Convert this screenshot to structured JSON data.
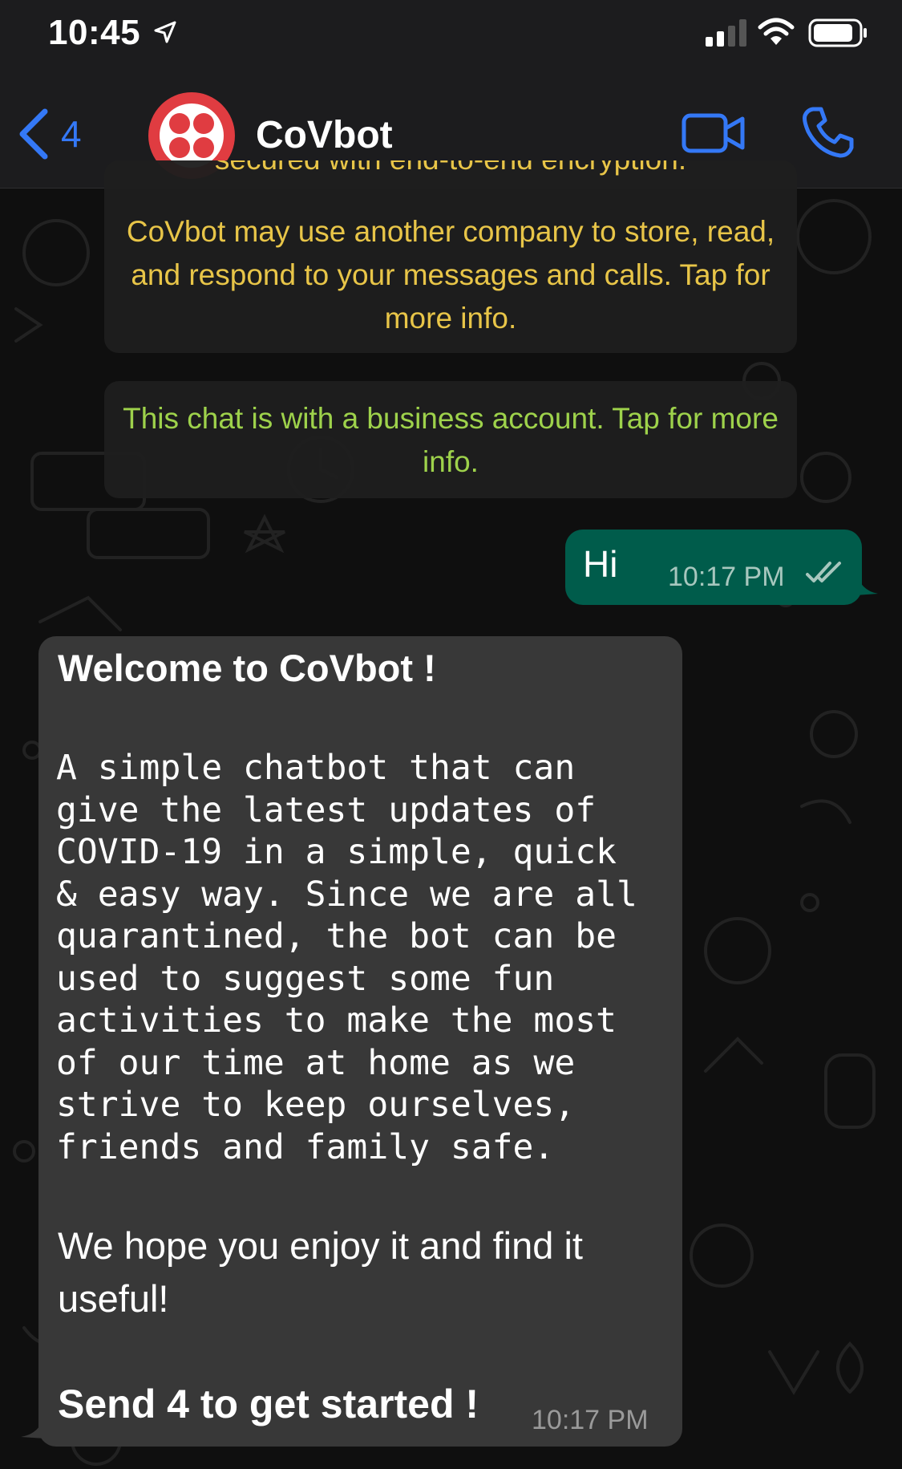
{
  "status_bar": {
    "time": "10:45",
    "icons": [
      "location-arrow-icon",
      "cellular-signal-icon",
      "wifi-icon",
      "battery-icon"
    ]
  },
  "header": {
    "back_count": "4",
    "contact_name": "CoVbot",
    "icons": [
      "chevron-left-icon",
      "video-call-icon",
      "phone-call-icon"
    ]
  },
  "notices": {
    "encryption_cut": "secured with end-to-end encryption.",
    "encryption": "CoVbot may use another company to store, read, and respond to your messages and calls. Tap for more info.",
    "business": "This chat is with a business account. Tap for more info."
  },
  "messages": {
    "outgoing": {
      "text": "Hi",
      "time": "10:17 PM",
      "status": "read"
    },
    "incoming": {
      "title": "Welcome to CoVbot !",
      "description": "A simple chatbot that can\ngive the latest updates of\nCOVID-19 in a simple, quick\n& easy way. Since we are all\nquarantined, the bot can be\nused to suggest some fun\nactivities to make the most\nof our time at home as we\nstrive to keep ourselves,\nfriends and family safe.",
      "closing": "We hope you enjoy it and find it useful!",
      "cta": "Send 4 to get started !",
      "time": "10:17 PM"
    }
  },
  "colors": {
    "ios_blue": "#3478f6",
    "outgoing_bubble": "#005c4b",
    "incoming_bubble": "#383838",
    "notice_text": "#e8c548",
    "business_notice_text": "#9ed24b",
    "avatar_red": "#e03c41"
  }
}
